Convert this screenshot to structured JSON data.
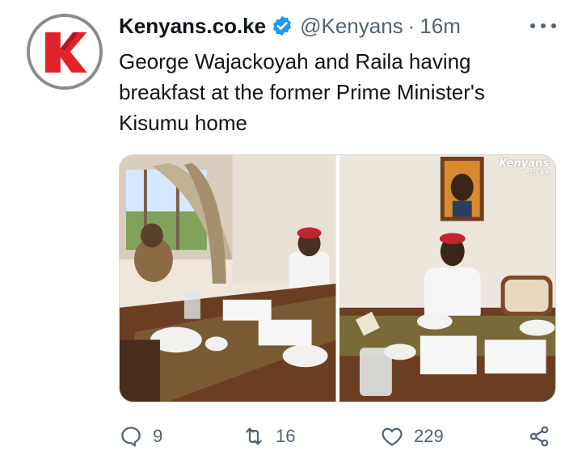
{
  "author": {
    "display_name": "Kenyans.co.ke",
    "handle": "@Kenyans",
    "separator": "·",
    "time_ago": "16m",
    "avatar_icon": "kenyans-logo",
    "verified_color": "#1d9bf0"
  },
  "tweet": {
    "text": "George Wajackoyah and Raila having breakfast at the former Prime Minister's Kisumu home"
  },
  "media": {
    "watermark_main": "Kenyans",
    "watermark_sub": ".co.ke"
  },
  "actions": {
    "replies": "9",
    "retweets": "16",
    "likes": "229"
  },
  "colors": {
    "brand_red": "#e0222a",
    "text_primary": "#0f1419",
    "text_secondary": "#536471"
  }
}
